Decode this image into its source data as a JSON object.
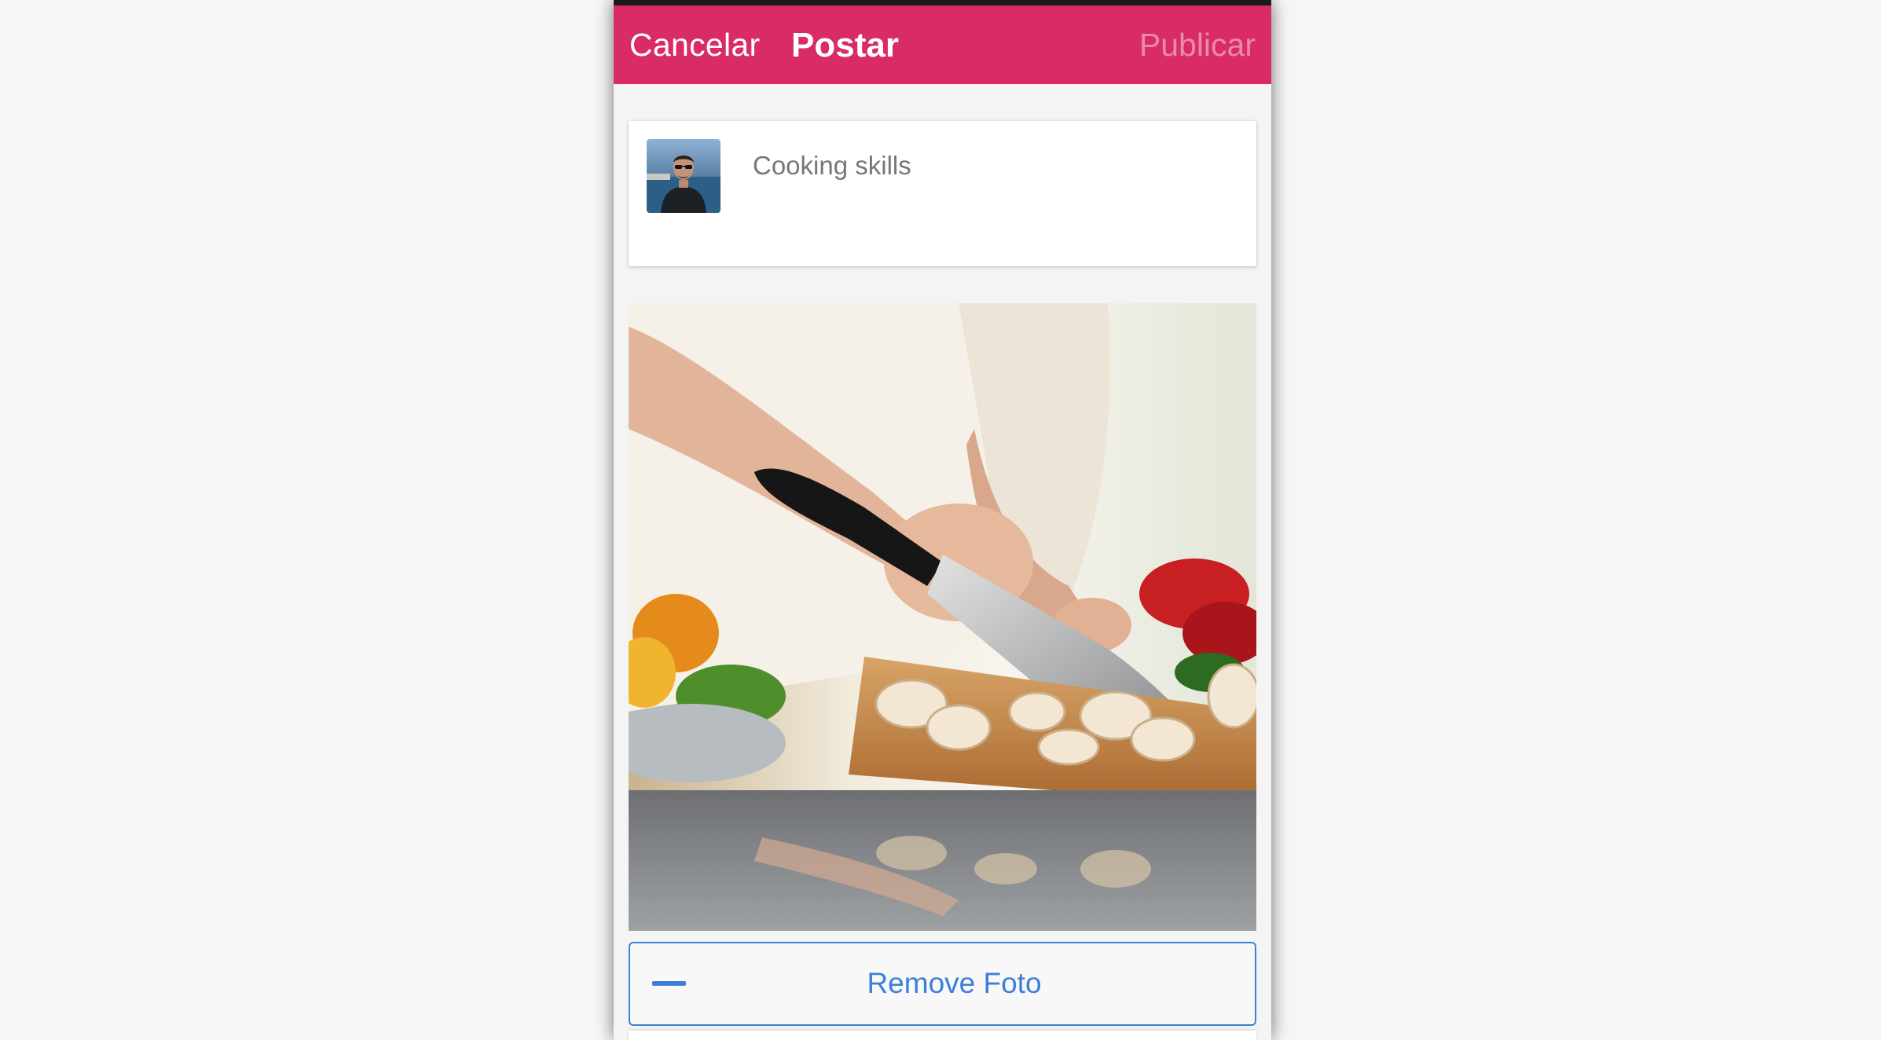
{
  "header": {
    "cancel_label": "Cancelar",
    "title": "Postar",
    "publish_label": "Publicar",
    "accent_color": "#d92b67"
  },
  "composer": {
    "text": "Cooking skills",
    "avatar_icon": "user-avatar"
  },
  "photo": {
    "subject": "cooking-photo"
  },
  "remove_button": {
    "label": "Remove Foto",
    "icon": "minus-icon",
    "color": "#3d7fd6"
  }
}
